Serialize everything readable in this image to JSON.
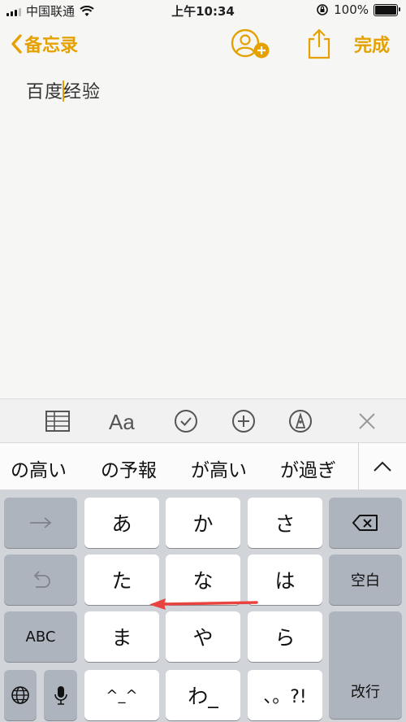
{
  "status": {
    "carrier": "中国联通",
    "time": "上午10:34",
    "battery": "100%"
  },
  "nav": {
    "back": "备忘录",
    "done": "完成"
  },
  "note": {
    "before_cursor": "百度",
    "after_cursor": "经验"
  },
  "candidates": [
    "の高い",
    "の予報",
    "が高い",
    "が過ぎ"
  ],
  "keyboard": {
    "r1": [
      "あ",
      "か",
      "さ"
    ],
    "r2": [
      "た",
      "な",
      "は"
    ],
    "r3": [
      "ま",
      "や",
      "ら"
    ],
    "r4": [
      "^_^",
      "わ_",
      "、。?!"
    ],
    "abc": "ABC",
    "space": "空白",
    "enter": "改行"
  },
  "colors": {
    "accent": "#e5a100",
    "annotation_arrow": "#e8433f"
  }
}
